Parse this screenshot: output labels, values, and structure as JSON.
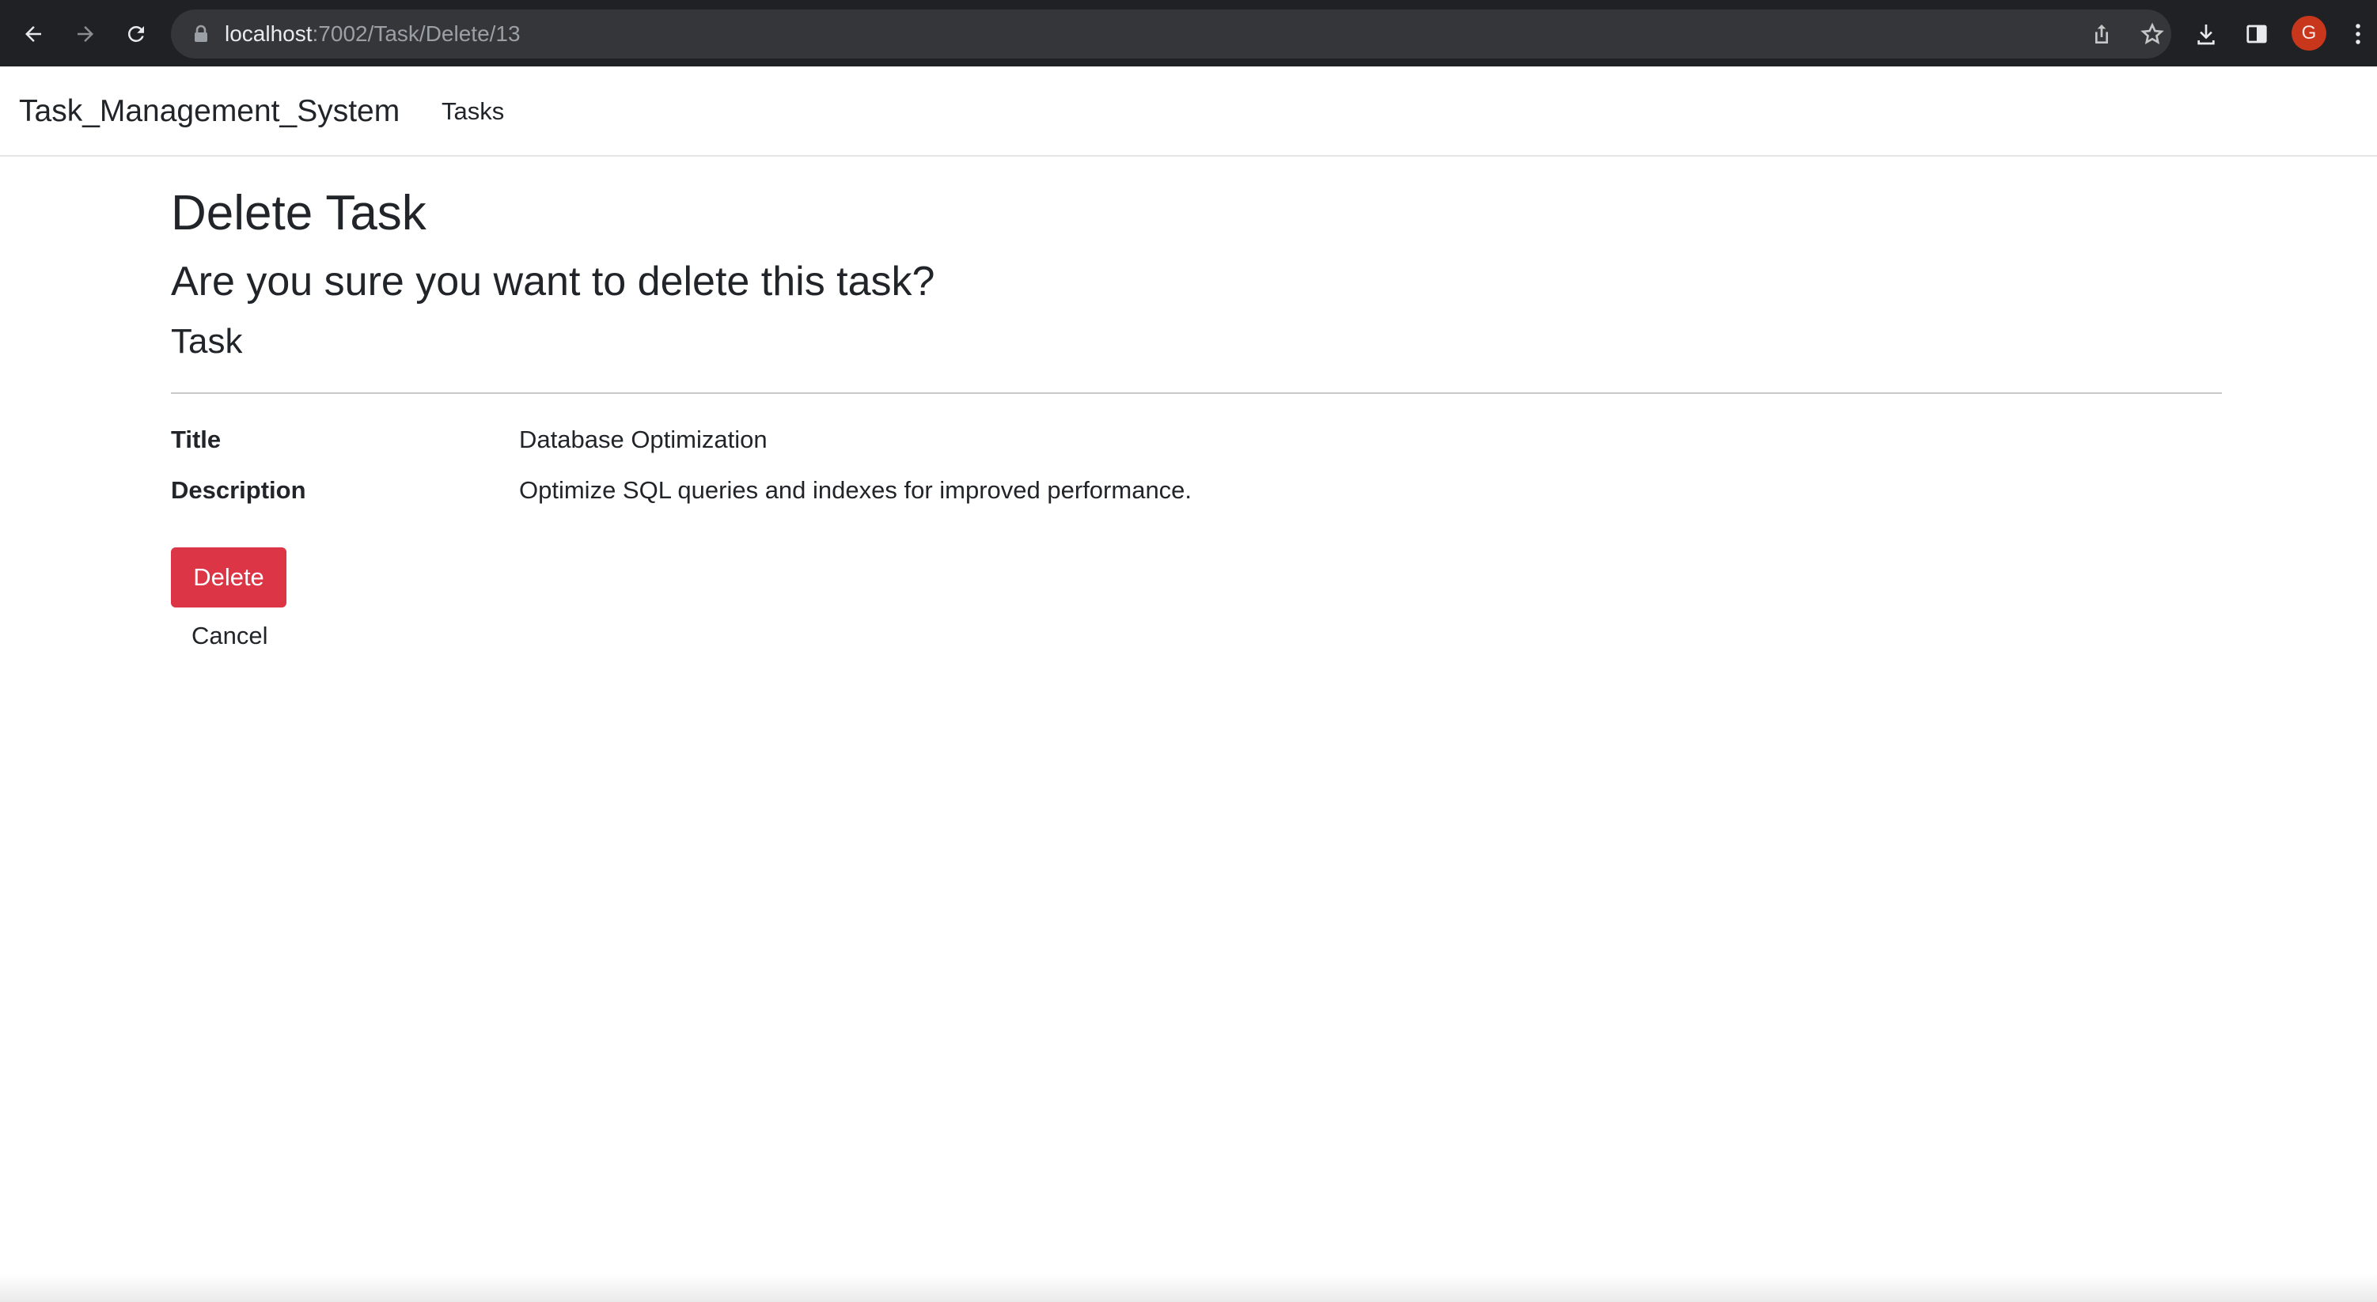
{
  "browser": {
    "url_host": "localhost",
    "url_path": ":7002/Task/Delete/13",
    "profile_initial": "G",
    "icons": [
      "back-arrow-icon",
      "forward-arrow-icon",
      "reload-icon",
      "lock-icon",
      "share-icon",
      "star-icon",
      "download-icon",
      "side-panel-icon",
      "kebab-menu-icon"
    ]
  },
  "navbar": {
    "brand": "Task_Management_System",
    "links": [
      "Tasks"
    ]
  },
  "page": {
    "title": "Delete Task",
    "question": "Are you sure you want to delete this task?",
    "section": "Task",
    "fields": [
      {
        "label": "Title",
        "value": "Database Optimization"
      },
      {
        "label": "Description",
        "value": "Optimize SQL queries and indexes for improved performance."
      }
    ],
    "delete_label": "Delete",
    "cancel_label": "Cancel"
  },
  "colors": {
    "danger": "#dc3545",
    "chrome_bg": "#202124",
    "omnibox_bg": "#35363a",
    "avatar": "#c8361b"
  }
}
